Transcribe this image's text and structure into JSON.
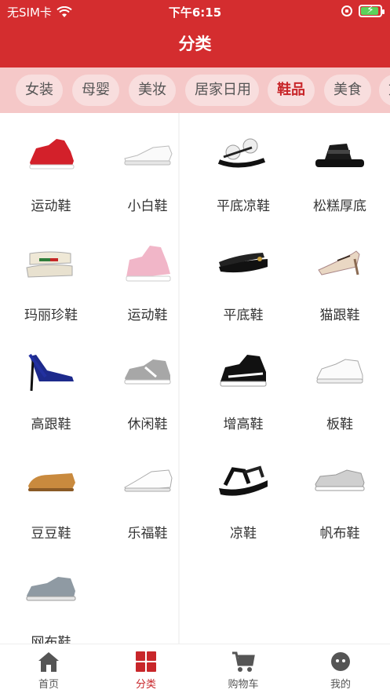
{
  "status": {
    "carrier": "无SIM卡",
    "time": "下午6:15"
  },
  "header": {
    "title": "分类"
  },
  "tabs": [
    {
      "label": "女装"
    },
    {
      "label": "母婴"
    },
    {
      "label": "美妆"
    },
    {
      "label": "居家日用"
    },
    {
      "label": "鞋品",
      "active": true
    },
    {
      "label": "美食"
    },
    {
      "label": "文"
    }
  ],
  "items": [
    {
      "label": "运动鞋",
      "icon": "red-sneaker-icon"
    },
    {
      "label": "小白鞋",
      "icon": "white-shoe-icon"
    },
    {
      "label": "平底凉鞋",
      "icon": "flower-sandal-icon"
    },
    {
      "label": "松糕厚底",
      "icon": "platform-sandal-icon"
    },
    {
      "label": "玛丽珍鞋",
      "icon": "mary-jane-icon"
    },
    {
      "label": "运动鞋",
      "icon": "pink-sneaker-icon"
    },
    {
      "label": "平底鞋",
      "icon": "black-flat-icon"
    },
    {
      "label": "猫跟鞋",
      "icon": "kitten-heel-icon"
    },
    {
      "label": "高跟鞋",
      "icon": "blue-heel-icon"
    },
    {
      "label": "休闲鞋",
      "icon": "grey-sneaker-icon"
    },
    {
      "label": "增高鞋",
      "icon": "black-sneaker-icon"
    },
    {
      "label": "板鞋",
      "icon": "white-skate-shoe-icon"
    },
    {
      "label": "豆豆鞋",
      "icon": "loafer-icon"
    },
    {
      "label": "乐福鞋",
      "icon": "white-loafer-icon"
    },
    {
      "label": "凉鞋",
      "icon": "men-sandal-icon"
    },
    {
      "label": "帆布鞋",
      "icon": "canvas-shoe-icon"
    },
    {
      "label": "网布鞋",
      "icon": "mesh-shoe-icon"
    }
  ],
  "nav": [
    {
      "label": "首页",
      "icon": "home-icon"
    },
    {
      "label": "分类",
      "icon": "grid-icon",
      "active": true
    },
    {
      "label": "购物车",
      "icon": "cart-icon"
    },
    {
      "label": "我的",
      "icon": "profile-icon"
    }
  ],
  "colors": {
    "brand": "#d42d2f",
    "tab_bar": "#f5c8c8",
    "active_text": "#c8262a"
  }
}
